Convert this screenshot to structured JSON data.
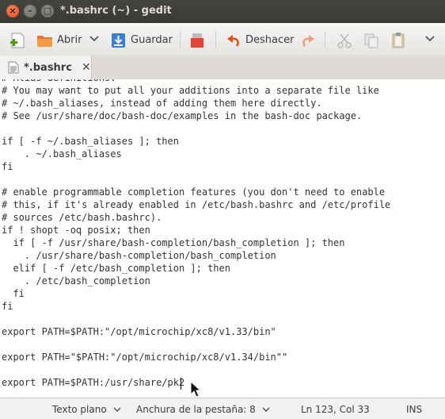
{
  "window": {
    "title": "*.bashrc (~) - gedit"
  },
  "toolbar": {
    "open_label": "Abrir",
    "save_label": "Guardar",
    "undo_label": "Deshacer"
  },
  "tab": {
    "label": "*.bashrc"
  },
  "editor": {
    "lines": [
      "# Alias definitions.",
      "# You may want to put all your additions into a separate file like",
      "# ~/.bash_aliases, instead of adding them here directly.",
      "# See /usr/share/doc/bash-doc/examples in the bash-doc package.",
      "",
      "if [ -f ~/.bash_aliases ]; then",
      "    . ~/.bash_aliases",
      "fi",
      "",
      "# enable programmable completion features (you don't need to enable",
      "# this, if it's already enabled in /etc/bash.bashrc and /etc/profile",
      "# sources /etc/bash.bashrc).",
      "if ! shopt -oq posix; then",
      "  if [ -f /usr/share/bash-completion/bash_completion ]; then",
      "    . /usr/share/bash-completion/bash_completion",
      "  elif [ -f /etc/bash_completion ]; then",
      "    . /etc/bash_completion",
      "  fi",
      "fi",
      "",
      "export PATH=$PATH:\"/opt/microchip/xc8/v1.33/bin\"",
      "",
      "export PATH=\"$PATH:\"/opt/microchip/xc8/v1.34/bin\"\"",
      "",
      "export PATH=$PATH:/usr/share/pk2"
    ]
  },
  "statusbar": {
    "language": "Texto plano",
    "tab_width": "Anchura de la pestaña: 8",
    "position": "Ln 123, Col 33",
    "mode": "INS"
  },
  "colors": {
    "titlebar": "#3c3b37",
    "close_button": "#e95420",
    "undo_arrow": "#d9541e",
    "save_blue": "#3b7fd1"
  }
}
